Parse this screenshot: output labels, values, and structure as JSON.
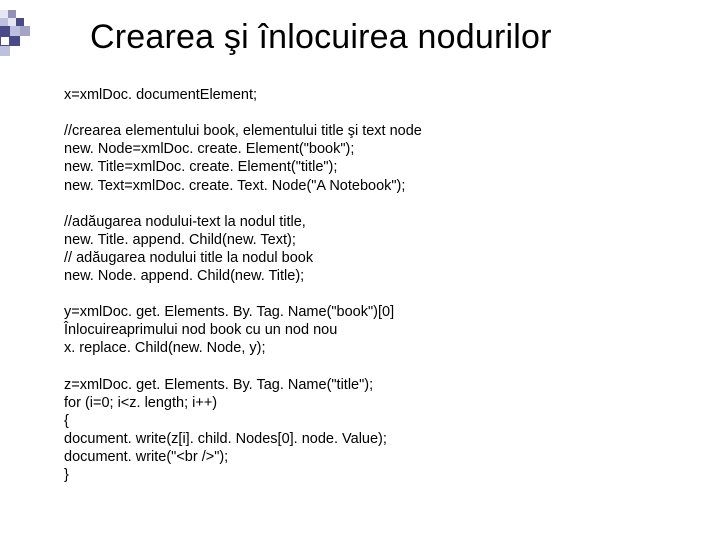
{
  "title": "Crearea şi înlocuirea nodurilor",
  "p1_l1": "x=xmlDoc. documentElement;",
  "p2_l1": "//crearea elementului book, elementului title şi text node",
  "p2_l2": "new. Node=xmlDoc. create. Element(\"book\");",
  "p2_l3": "new. Title=xmlDoc. create. Element(\"title\");",
  "p2_l4": "new. Text=xmlDoc. create. Text. Node(\"A Notebook\");",
  "p3_l1": "//adăugarea nodului-text la nodul title,",
  "p3_l2": "new. Title. append. Child(new. Text);",
  "p3_l3": "// adăugarea nodului title la nodul book",
  "p3_l4": "new. Node. append. Child(new. Title);",
  "p4_l1": "y=xmlDoc. get. Elements. By. Tag. Name(\"book\")[0]",
  "p4_l2": "Înlocuireaprimului nod book cu un nod nou",
  "p4_l3": "x. replace. Child(new. Node, y);",
  "p5_l1": "z=xmlDoc. get. Elements. By. Tag. Name(\"title\");",
  "p5_l2": "for (i=0; i<z. length; i++)",
  "p5_l3": "{",
  "p5_l4": "document. write(z[i]. child. Nodes[0]. node. Value);",
  "p5_l5": "document. write(\"<br />\");",
  "p5_l6": "}"
}
